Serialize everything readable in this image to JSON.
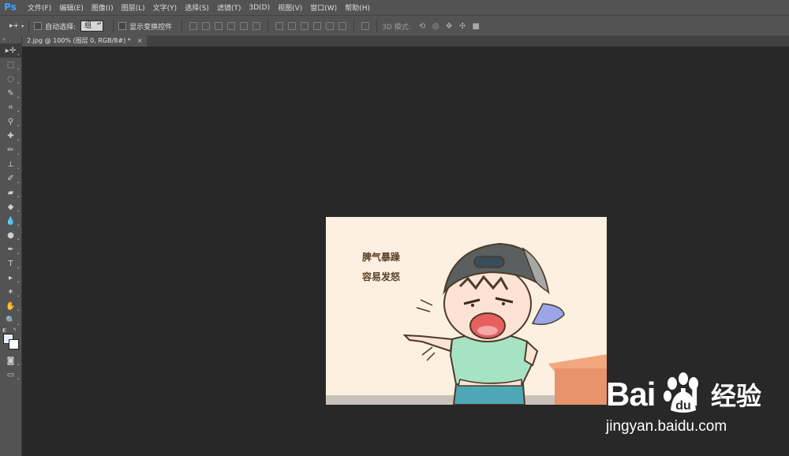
{
  "app": {
    "logo": "Ps"
  },
  "menu": [
    "文件(F)",
    "编辑(E)",
    "图像(I)",
    "图层(L)",
    "文字(Y)",
    "选择(S)",
    "滤镜(T)",
    "3D(D)",
    "视图(V)",
    "窗口(W)",
    "帮助(H)"
  ],
  "options": {
    "tool_preset_glyph": "▸+",
    "auto_select_label": "自动选择:",
    "auto_select_value": "组",
    "show_transform_label": "显示变换控件",
    "mode3d_label": "3D 模式:"
  },
  "document": {
    "tab_title": "2.jpg @ 100% (图层 0, RGB/8#) *",
    "close_glyph": "×"
  },
  "image_content": {
    "caption_line1": "脾气暴躁",
    "caption_line2": "容易发怒"
  },
  "watermark": {
    "brand_latin": "Bai",
    "brand_latin_tail": "u",
    "brand_cn": "经验",
    "url": "jingyan.baidu.com"
  },
  "colors": {
    "accent": "#31a8ff",
    "panel": "#535353",
    "canvas": "#282828",
    "image_bg": "#fdf0e1"
  }
}
